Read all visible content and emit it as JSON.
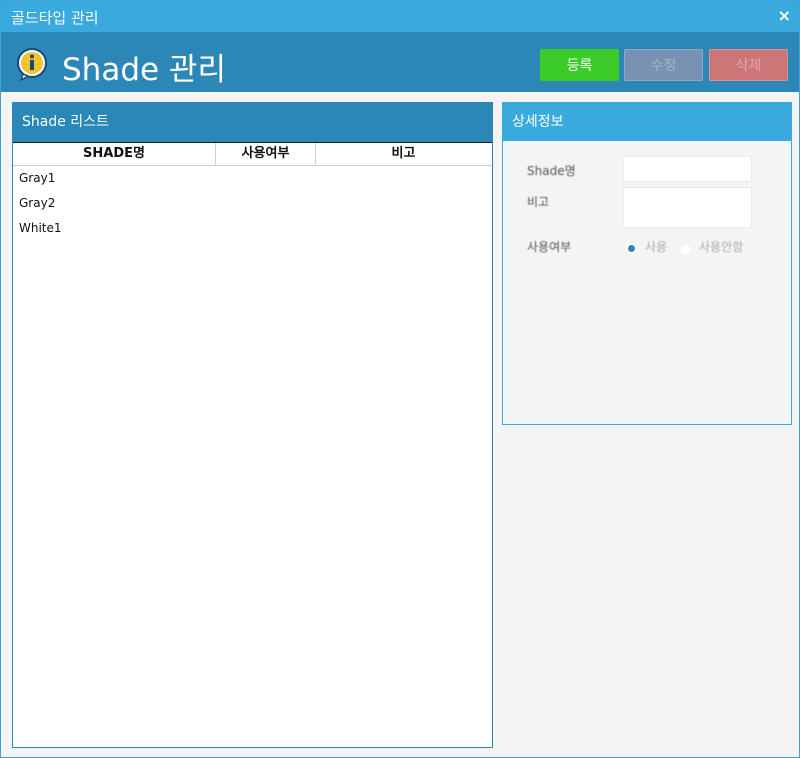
{
  "window": {
    "title": "골드타입 관리",
    "close_label": "×"
  },
  "header": {
    "title": "Shade 관리",
    "buttons": {
      "register": "등록",
      "edit": "수정",
      "delete": "삭제"
    }
  },
  "list_panel": {
    "title": "Shade 리스트",
    "columns": [
      "SHADE명",
      "사용여부",
      "비고"
    ],
    "rows": [
      {
        "name": "Gray1",
        "use": "",
        "note": ""
      },
      {
        "name": "Gray2",
        "use": "",
        "note": ""
      },
      {
        "name": "White1",
        "use": "",
        "note": ""
      }
    ]
  },
  "detail_panel": {
    "title": "상세정보",
    "fields": {
      "shade_name_label": "Shade명",
      "note_label": "비고",
      "use_label": "사용여부"
    },
    "use_options": [
      "사용",
      "사용안함"
    ],
    "use_selected": "사용"
  },
  "colors": {
    "titlebar": "#3aa9de",
    "header": "#2c87b6",
    "register": "#3ccc2a",
    "edit": "#7792b2",
    "delete": "#cc7678"
  }
}
